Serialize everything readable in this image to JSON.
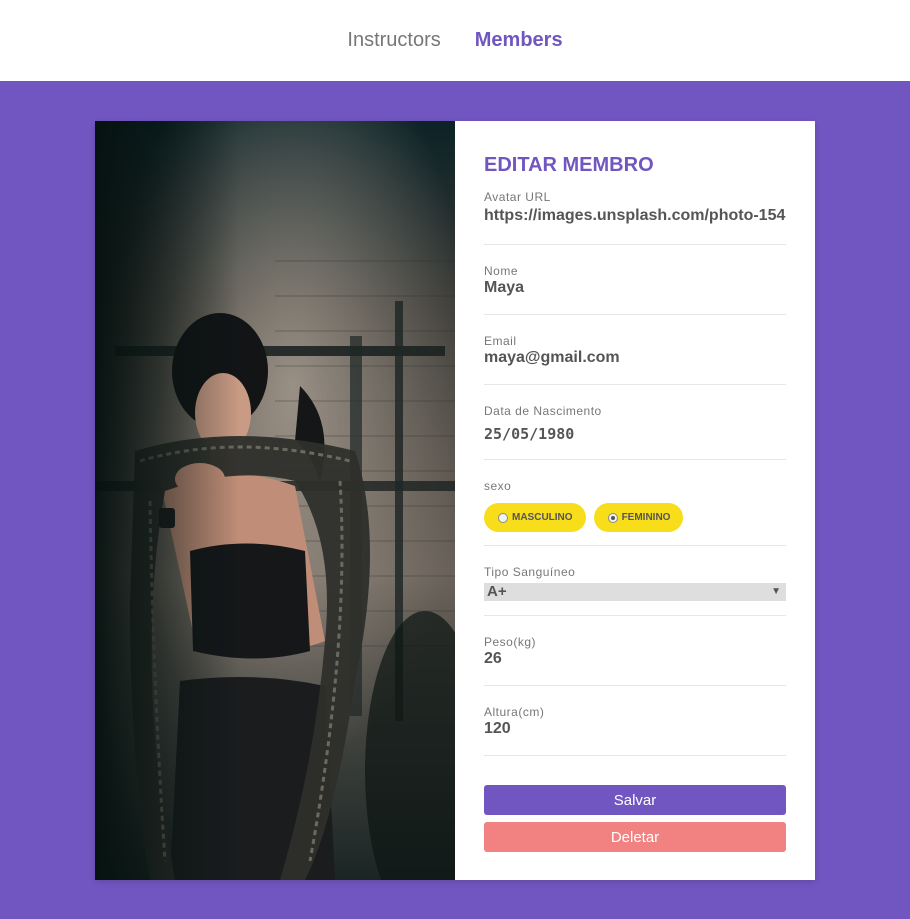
{
  "nav": {
    "items": [
      {
        "label": "Instructors",
        "active": false
      },
      {
        "label": "Members",
        "active": true
      }
    ]
  },
  "form": {
    "title": "EDITAR MEMBRO",
    "avatar": {
      "label": "Avatar URL",
      "value": "https://images.unsplash.com/photo-154"
    },
    "name": {
      "label": "Nome",
      "value": "Maya"
    },
    "email": {
      "label": "Email",
      "value": "maya@gmail.com"
    },
    "birth": {
      "label": "Data de Nascimento",
      "value": "25/05/1980"
    },
    "gender": {
      "label": "sexo",
      "options": [
        {
          "label": "MASCULINO",
          "checked": false
        },
        {
          "label": "FEMININO",
          "checked": true
        }
      ]
    },
    "blood": {
      "label": "Tipo Sanguíneo",
      "value": "A+"
    },
    "weight": {
      "label": "Peso(kg)",
      "value": "26"
    },
    "height": {
      "label": "Altura(cm)",
      "value": "120"
    },
    "save_label": "Salvar",
    "delete_label": "Deletar"
  },
  "colors": {
    "accent": "#7156c1",
    "pill": "#f7dd1a",
    "delete": "#f28181"
  }
}
